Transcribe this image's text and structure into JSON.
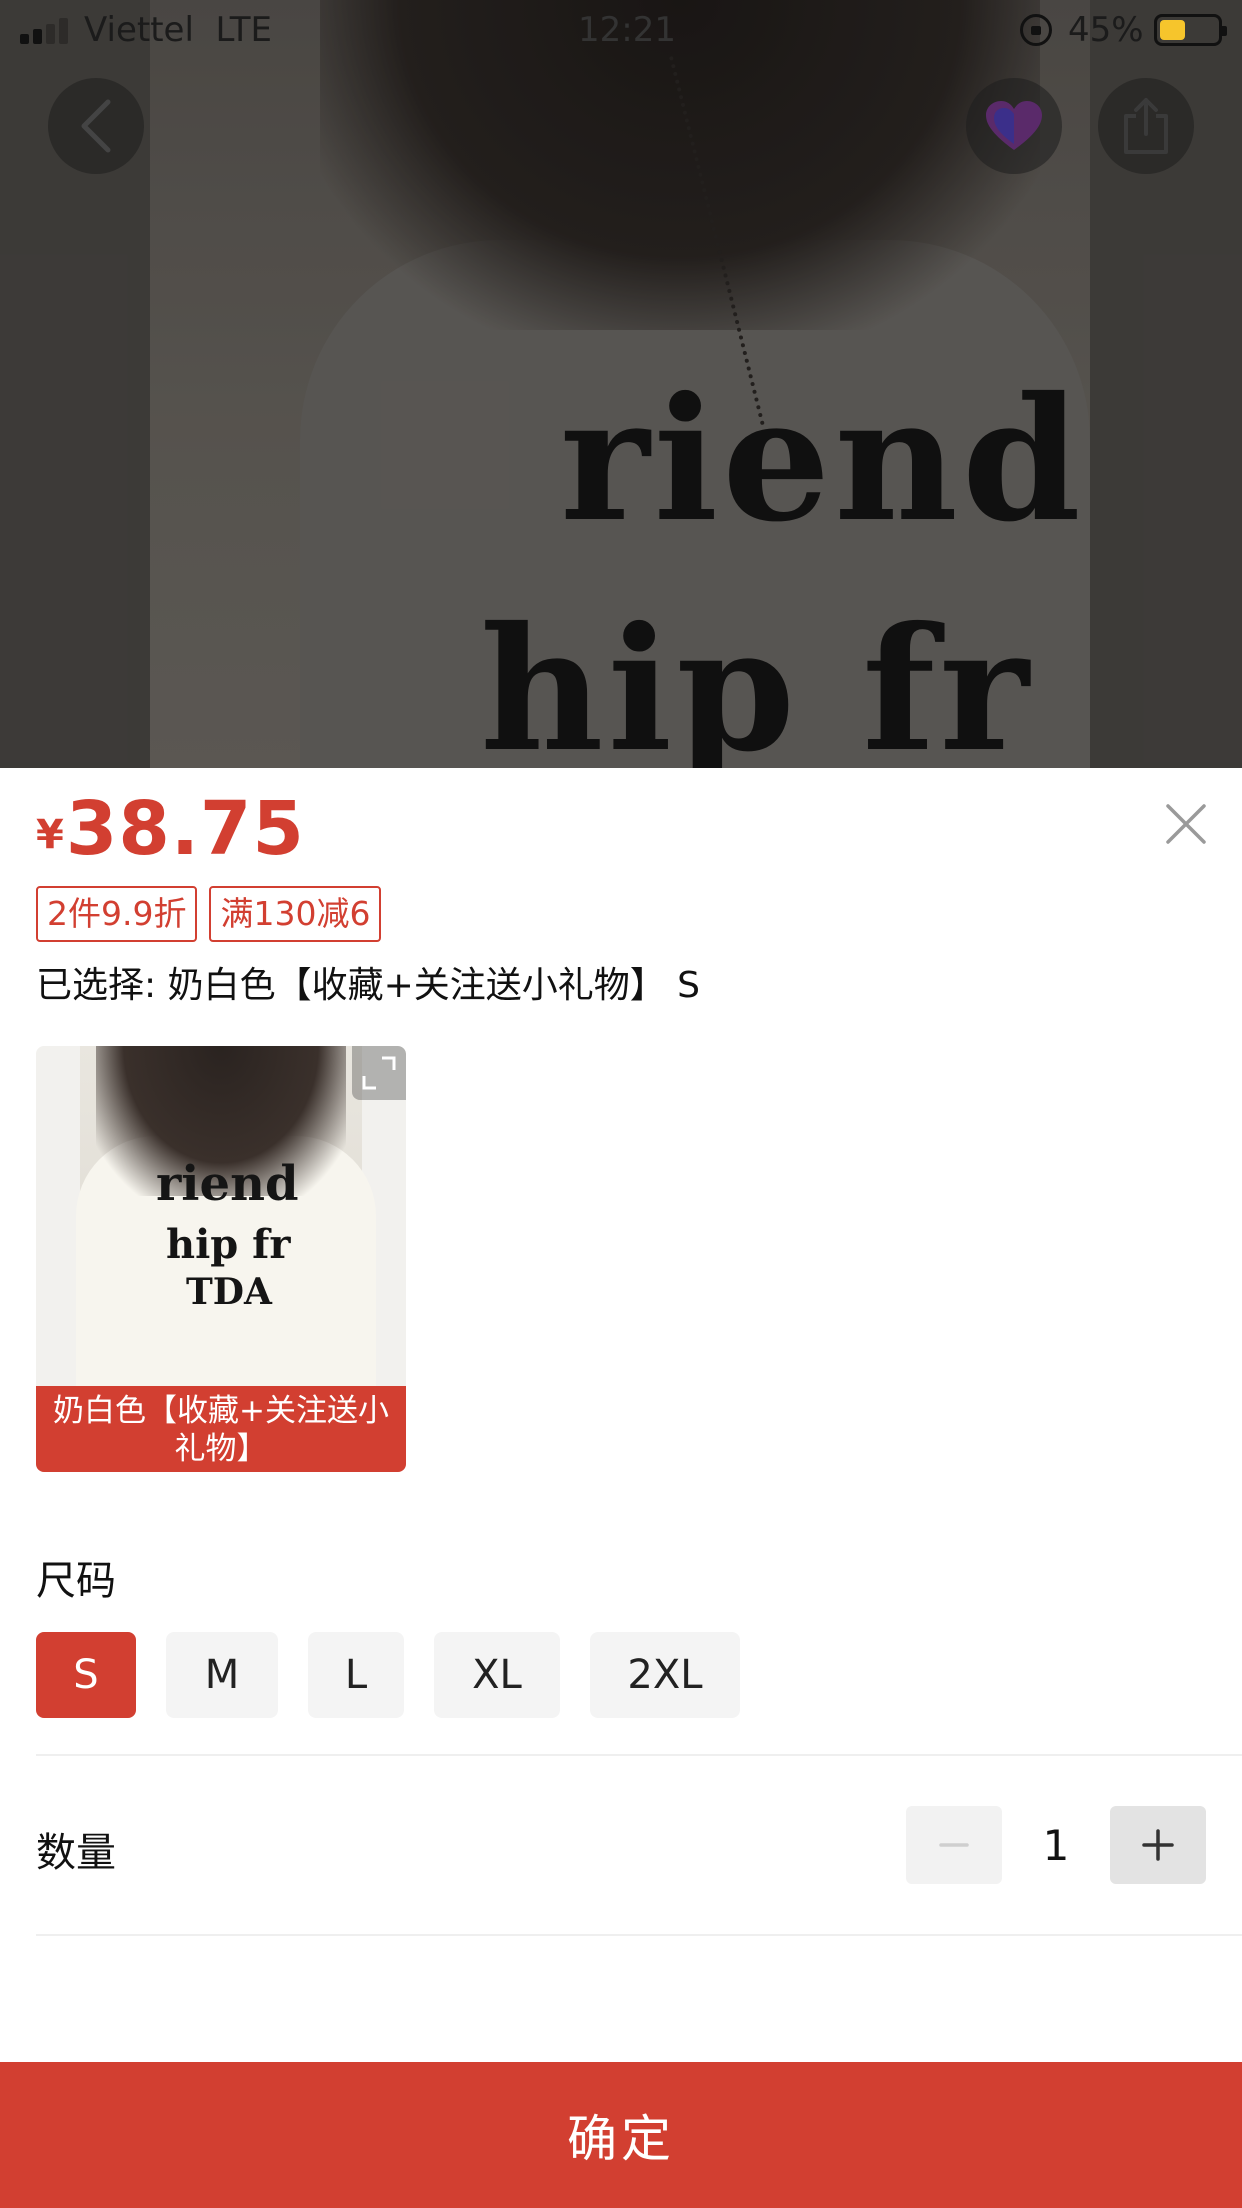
{
  "status_bar": {
    "carrier": "Viettel",
    "network": "LTE",
    "time": "12:21",
    "battery_percent": "45%",
    "battery_level": 0.45,
    "signal_bars_active": 2,
    "signal_bars_total": 4
  },
  "header": {
    "back_icon": "chevron-left-icon",
    "favorite_icon": "heart-icon",
    "share_icon": "share-icon"
  },
  "hero_image": {
    "print_line_1": "riend",
    "print_line_2": "hip fr"
  },
  "product": {
    "currency": "¥",
    "price": "38.75",
    "promo_tags": [
      "2件9.9折",
      "满130减6"
    ],
    "selected_text": "已选择: 奶白色【收藏+关注送小礼物】 S"
  },
  "variant": {
    "label": "奶白色【收藏+关注送小礼物】",
    "thumb_print_1": "riend",
    "thumb_print_2": "hip fr",
    "thumb_print_3": "TDA",
    "expand_icon": "expand-icon"
  },
  "size_section": {
    "title": "尺码",
    "options": [
      "S",
      "M",
      "L",
      "XL",
      "2XL"
    ],
    "selected": "S"
  },
  "quantity": {
    "title": "数量",
    "minus": "−",
    "plus": "+",
    "value": "1"
  },
  "confirm_label": "确定",
  "colors": {
    "accent": "#d23f31",
    "chip_bg": "#f4f4f4",
    "battery": "#f6c52c"
  }
}
